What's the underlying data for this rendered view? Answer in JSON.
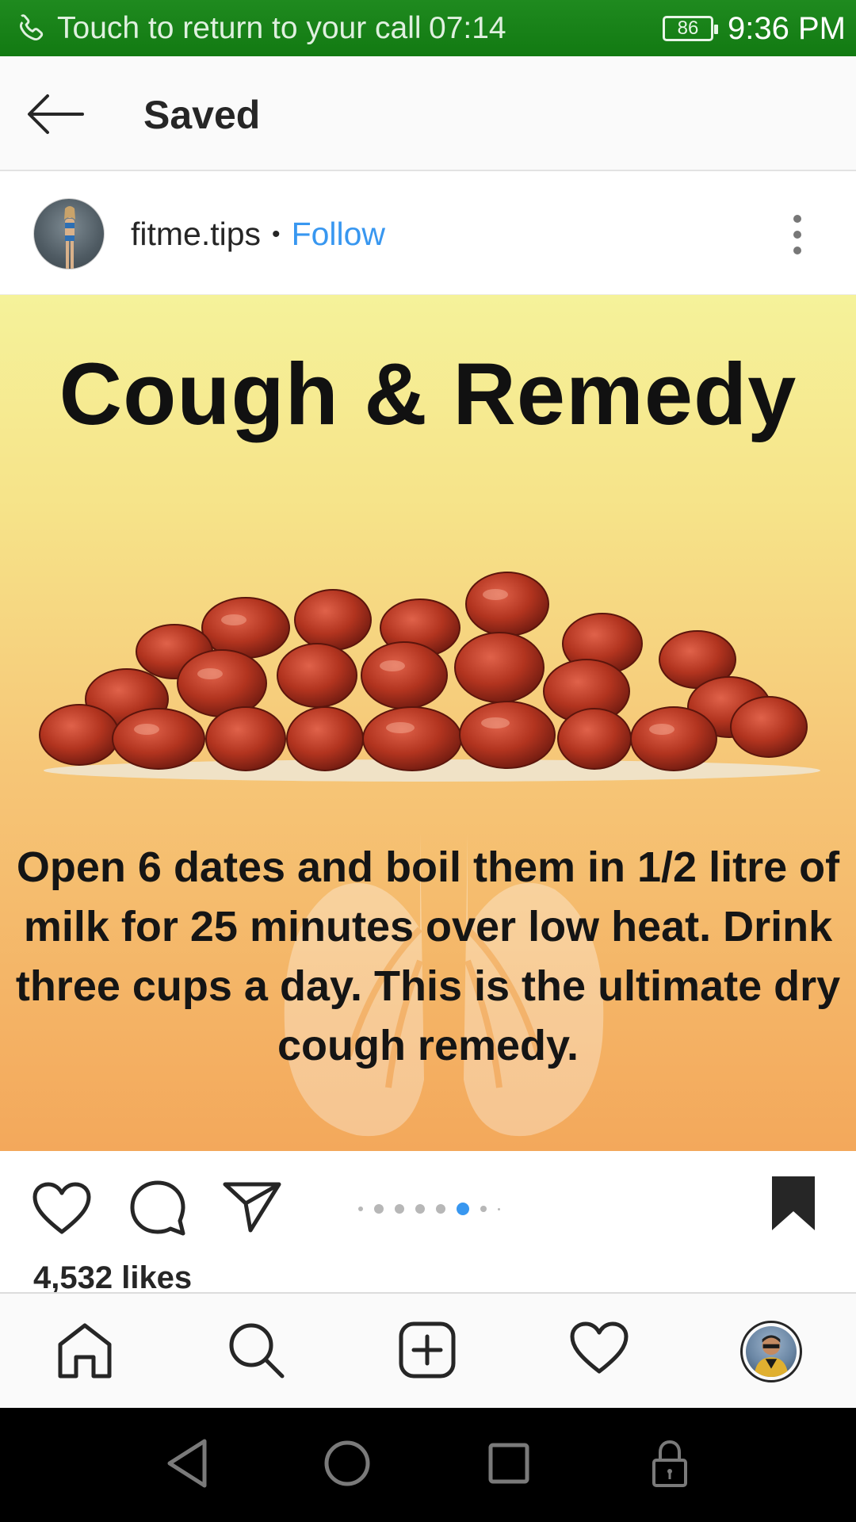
{
  "status_bar": {
    "call_text": "Touch to return to your call",
    "call_timer": "07:14",
    "battery": "86",
    "clock": "9:36 PM"
  },
  "header": {
    "title": "Saved"
  },
  "post": {
    "username": "fitme.tips",
    "separator": "•",
    "follow_label": "Follow",
    "image_title": "Cough & Remedy",
    "image_text": "Open 6 dates and boil them in 1/2 litre of milk for 25 minutes over low heat. Drink three cups a day. This is the ultimate dry cough remedy.",
    "likes": "4,532 likes",
    "carousel": {
      "count": 8,
      "active_index": 5
    }
  },
  "colors": {
    "status_green": "#1f8a1f",
    "follow_blue": "#3897f0",
    "active_dot": "#3897f0",
    "text_dark": "#262626"
  },
  "icons": {
    "status": [
      "phone-icon",
      "battery-icon"
    ],
    "header": [
      "back-arrow-icon"
    ],
    "post": [
      "more-vertical-icon",
      "heart-icon",
      "comment-icon",
      "share-icon",
      "bookmark-icon"
    ],
    "bottom_nav": [
      "home-icon",
      "search-icon",
      "add-post-icon",
      "activity-heart-icon",
      "profile-avatar"
    ],
    "system_nav": [
      "back-triangle-icon",
      "home-circle-icon",
      "recents-square-icon",
      "lock-icon"
    ]
  }
}
